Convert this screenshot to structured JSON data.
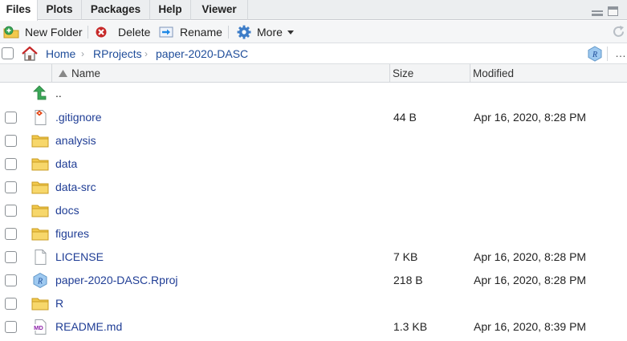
{
  "tabs": [
    {
      "label": "Files",
      "active": true
    },
    {
      "label": "Plots"
    },
    {
      "label": "Packages"
    },
    {
      "label": "Help"
    },
    {
      "label": "Viewer"
    }
  ],
  "toolbar": {
    "new_folder": "New Folder",
    "delete": "Delete",
    "rename": "Rename",
    "more": "More"
  },
  "breadcrumb": [
    "Home",
    "RProjects",
    "paper-2020-DASC"
  ],
  "columns": {
    "name": "Name",
    "size": "Size",
    "modified": "Modified"
  },
  "parent_dir": "..",
  "files": [
    {
      "name": ".gitignore",
      "type": "gitignore",
      "size": "44 B",
      "modified": "Apr 16, 2020, 8:28 PM"
    },
    {
      "name": "analysis",
      "type": "folder",
      "size": "",
      "modified": ""
    },
    {
      "name": "data",
      "type": "folder",
      "size": "",
      "modified": ""
    },
    {
      "name": "data-src",
      "type": "folder",
      "size": "",
      "modified": ""
    },
    {
      "name": "docs",
      "type": "folder",
      "size": "",
      "modified": ""
    },
    {
      "name": "figures",
      "type": "folder",
      "size": "",
      "modified": ""
    },
    {
      "name": "LICENSE",
      "type": "file",
      "size": "7 KB",
      "modified": "Apr 16, 2020, 8:28 PM"
    },
    {
      "name": "paper-2020-DASC.Rproj",
      "type": "rproj",
      "size": "218 B",
      "modified": "Apr 16, 2020, 8:28 PM"
    },
    {
      "name": "R",
      "type": "folder",
      "size": "",
      "modified": ""
    },
    {
      "name": "README.md",
      "type": "markdown",
      "size": "1.3 KB",
      "modified": "Apr 16, 2020, 8:39 PM"
    }
  ],
  "icons": {
    "folder": "folder-icon",
    "file": "file-icon",
    "gitignore": "git-file-icon",
    "rproj": "rproj-icon",
    "markdown": "markdown-icon"
  },
  "colors": {
    "link": "#1f3d95",
    "folder": "#f2c94c",
    "accent_green": "#3aa757"
  }
}
